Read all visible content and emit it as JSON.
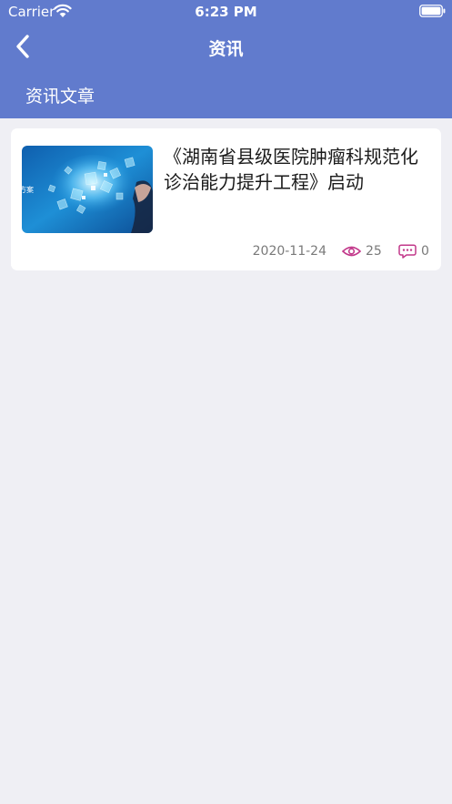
{
  "status_bar": {
    "carrier": "Carrier",
    "time": "6:23 PM"
  },
  "nav": {
    "title": "资讯",
    "back_icon": "chevron-left-icon"
  },
  "section": {
    "label": "资讯文章"
  },
  "articles": [
    {
      "title": "《湖南省县级医院肿瘤科规范化诊治能力提升工程》启动",
      "thumbnail_caption": "方案",
      "date": "2020-11-24",
      "views": "25",
      "comments": "0",
      "view_icon": "eye-icon",
      "comment_icon": "comment-bubble-icon"
    }
  ],
  "colors": {
    "header": "#617bcd",
    "background": "#efeff4",
    "icon_accent": "#c2388a"
  }
}
